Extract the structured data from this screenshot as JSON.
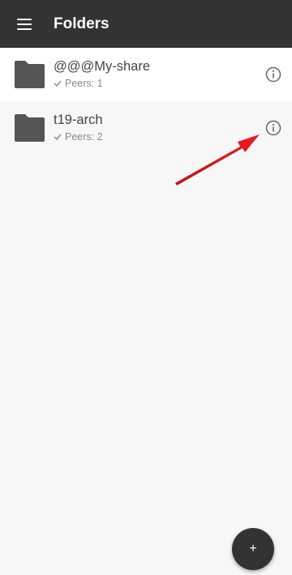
{
  "appbar": {
    "title": "Folders",
    "menu_icon": "hamburger-menu-icon"
  },
  "folders": [
    {
      "name": "@@@My-share",
      "peers": "Peers: 1",
      "status_icon": "check-icon",
      "info_icon": "info-icon"
    },
    {
      "name": "t19-arch",
      "peers": "Peers: 2",
      "status_icon": "check-icon",
      "info_icon": "info-icon"
    }
  ],
  "fab": {
    "label": "+",
    "icon": "add-icon"
  },
  "colors": {
    "appbar": "#333333",
    "arrow": "#e0141b",
    "folder_icon": "#555555",
    "background": "#f7f7f7"
  }
}
